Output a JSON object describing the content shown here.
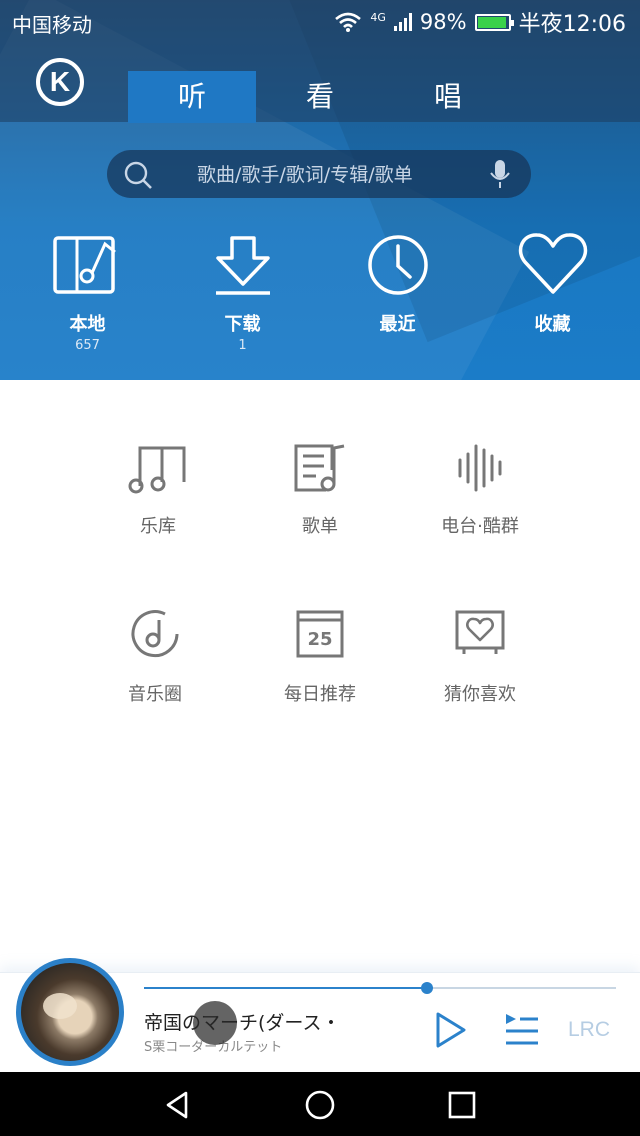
{
  "status_bar": {
    "carrier": "中国移动",
    "network": "4G",
    "battery": "98%",
    "time": "半夜12:06"
  },
  "header": {
    "logo": "K",
    "tabs": [
      {
        "label": "听",
        "active": true
      },
      {
        "label": "看",
        "active": false
      },
      {
        "label": "唱",
        "active": false
      }
    ],
    "search_placeholder": "歌曲/歌手/歌词/专辑/歌单"
  },
  "quick_access": [
    {
      "label": "本地",
      "count": "657",
      "icon": "local-music-icon"
    },
    {
      "label": "下载",
      "count": "1",
      "icon": "download-icon"
    },
    {
      "label": "最近",
      "count": "",
      "icon": "clock-icon"
    },
    {
      "label": "收藏",
      "count": "",
      "icon": "heart-icon"
    }
  ],
  "grid": [
    {
      "label": "乐库",
      "icon": "music-library-icon"
    },
    {
      "label": "歌单",
      "icon": "playlist-icon"
    },
    {
      "label": "电台·酷群",
      "icon": "radio-icon"
    },
    {
      "label": "音乐圈",
      "icon": "music-circle-icon"
    },
    {
      "label": "每日推荐",
      "icon": "calendar-icon",
      "day": "25"
    },
    {
      "label": "猜你喜欢",
      "icon": "heart-tv-icon"
    }
  ],
  "player": {
    "title": "帝国のマーチ(ダース・",
    "artist": "S栗コーダーカルテット",
    "progress": 0.6,
    "lrc_label": "LRC"
  },
  "colors": {
    "accent": "#2b82cb",
    "header_blue": "#1b7cc8"
  }
}
